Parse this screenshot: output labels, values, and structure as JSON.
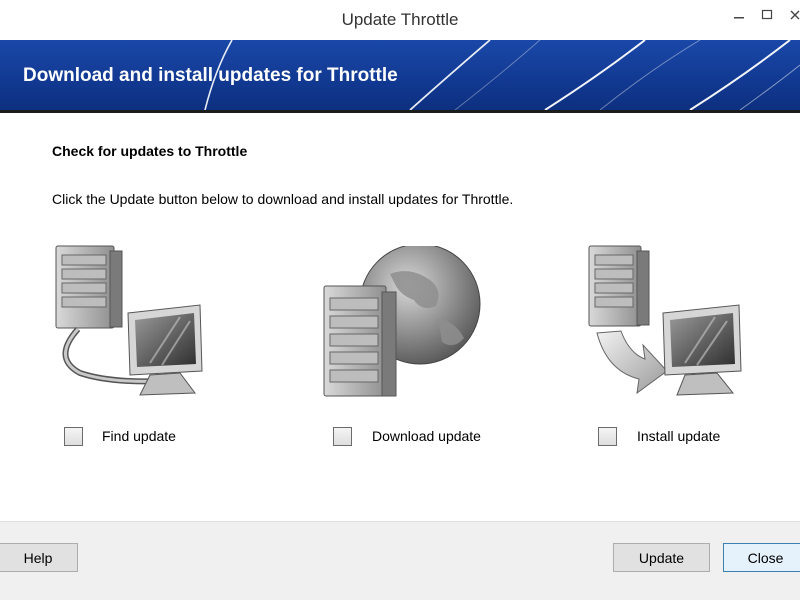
{
  "window": {
    "title": "Update Throttle",
    "controls": [
      "minimize-icon",
      "maximize-icon",
      "close-icon"
    ]
  },
  "banner": {
    "title": "Download and install updates for Throttle",
    "colors": {
      "top": "#1a48a8",
      "bottom": "#0d2f7f"
    }
  },
  "content": {
    "heading": "Check for updates to Throttle",
    "description": "Click the Update button below to download and install updates for Throttle."
  },
  "steps": [
    {
      "label": "Find update",
      "icon": "server-to-computer-icon",
      "checked": false
    },
    {
      "label": "Download update",
      "icon": "server-globe-icon",
      "checked": false
    },
    {
      "label": "Install update",
      "icon": "server-install-arrow-icon",
      "checked": false
    }
  ],
  "buttons": {
    "help": "Help",
    "update": "Update",
    "close": "Close"
  }
}
